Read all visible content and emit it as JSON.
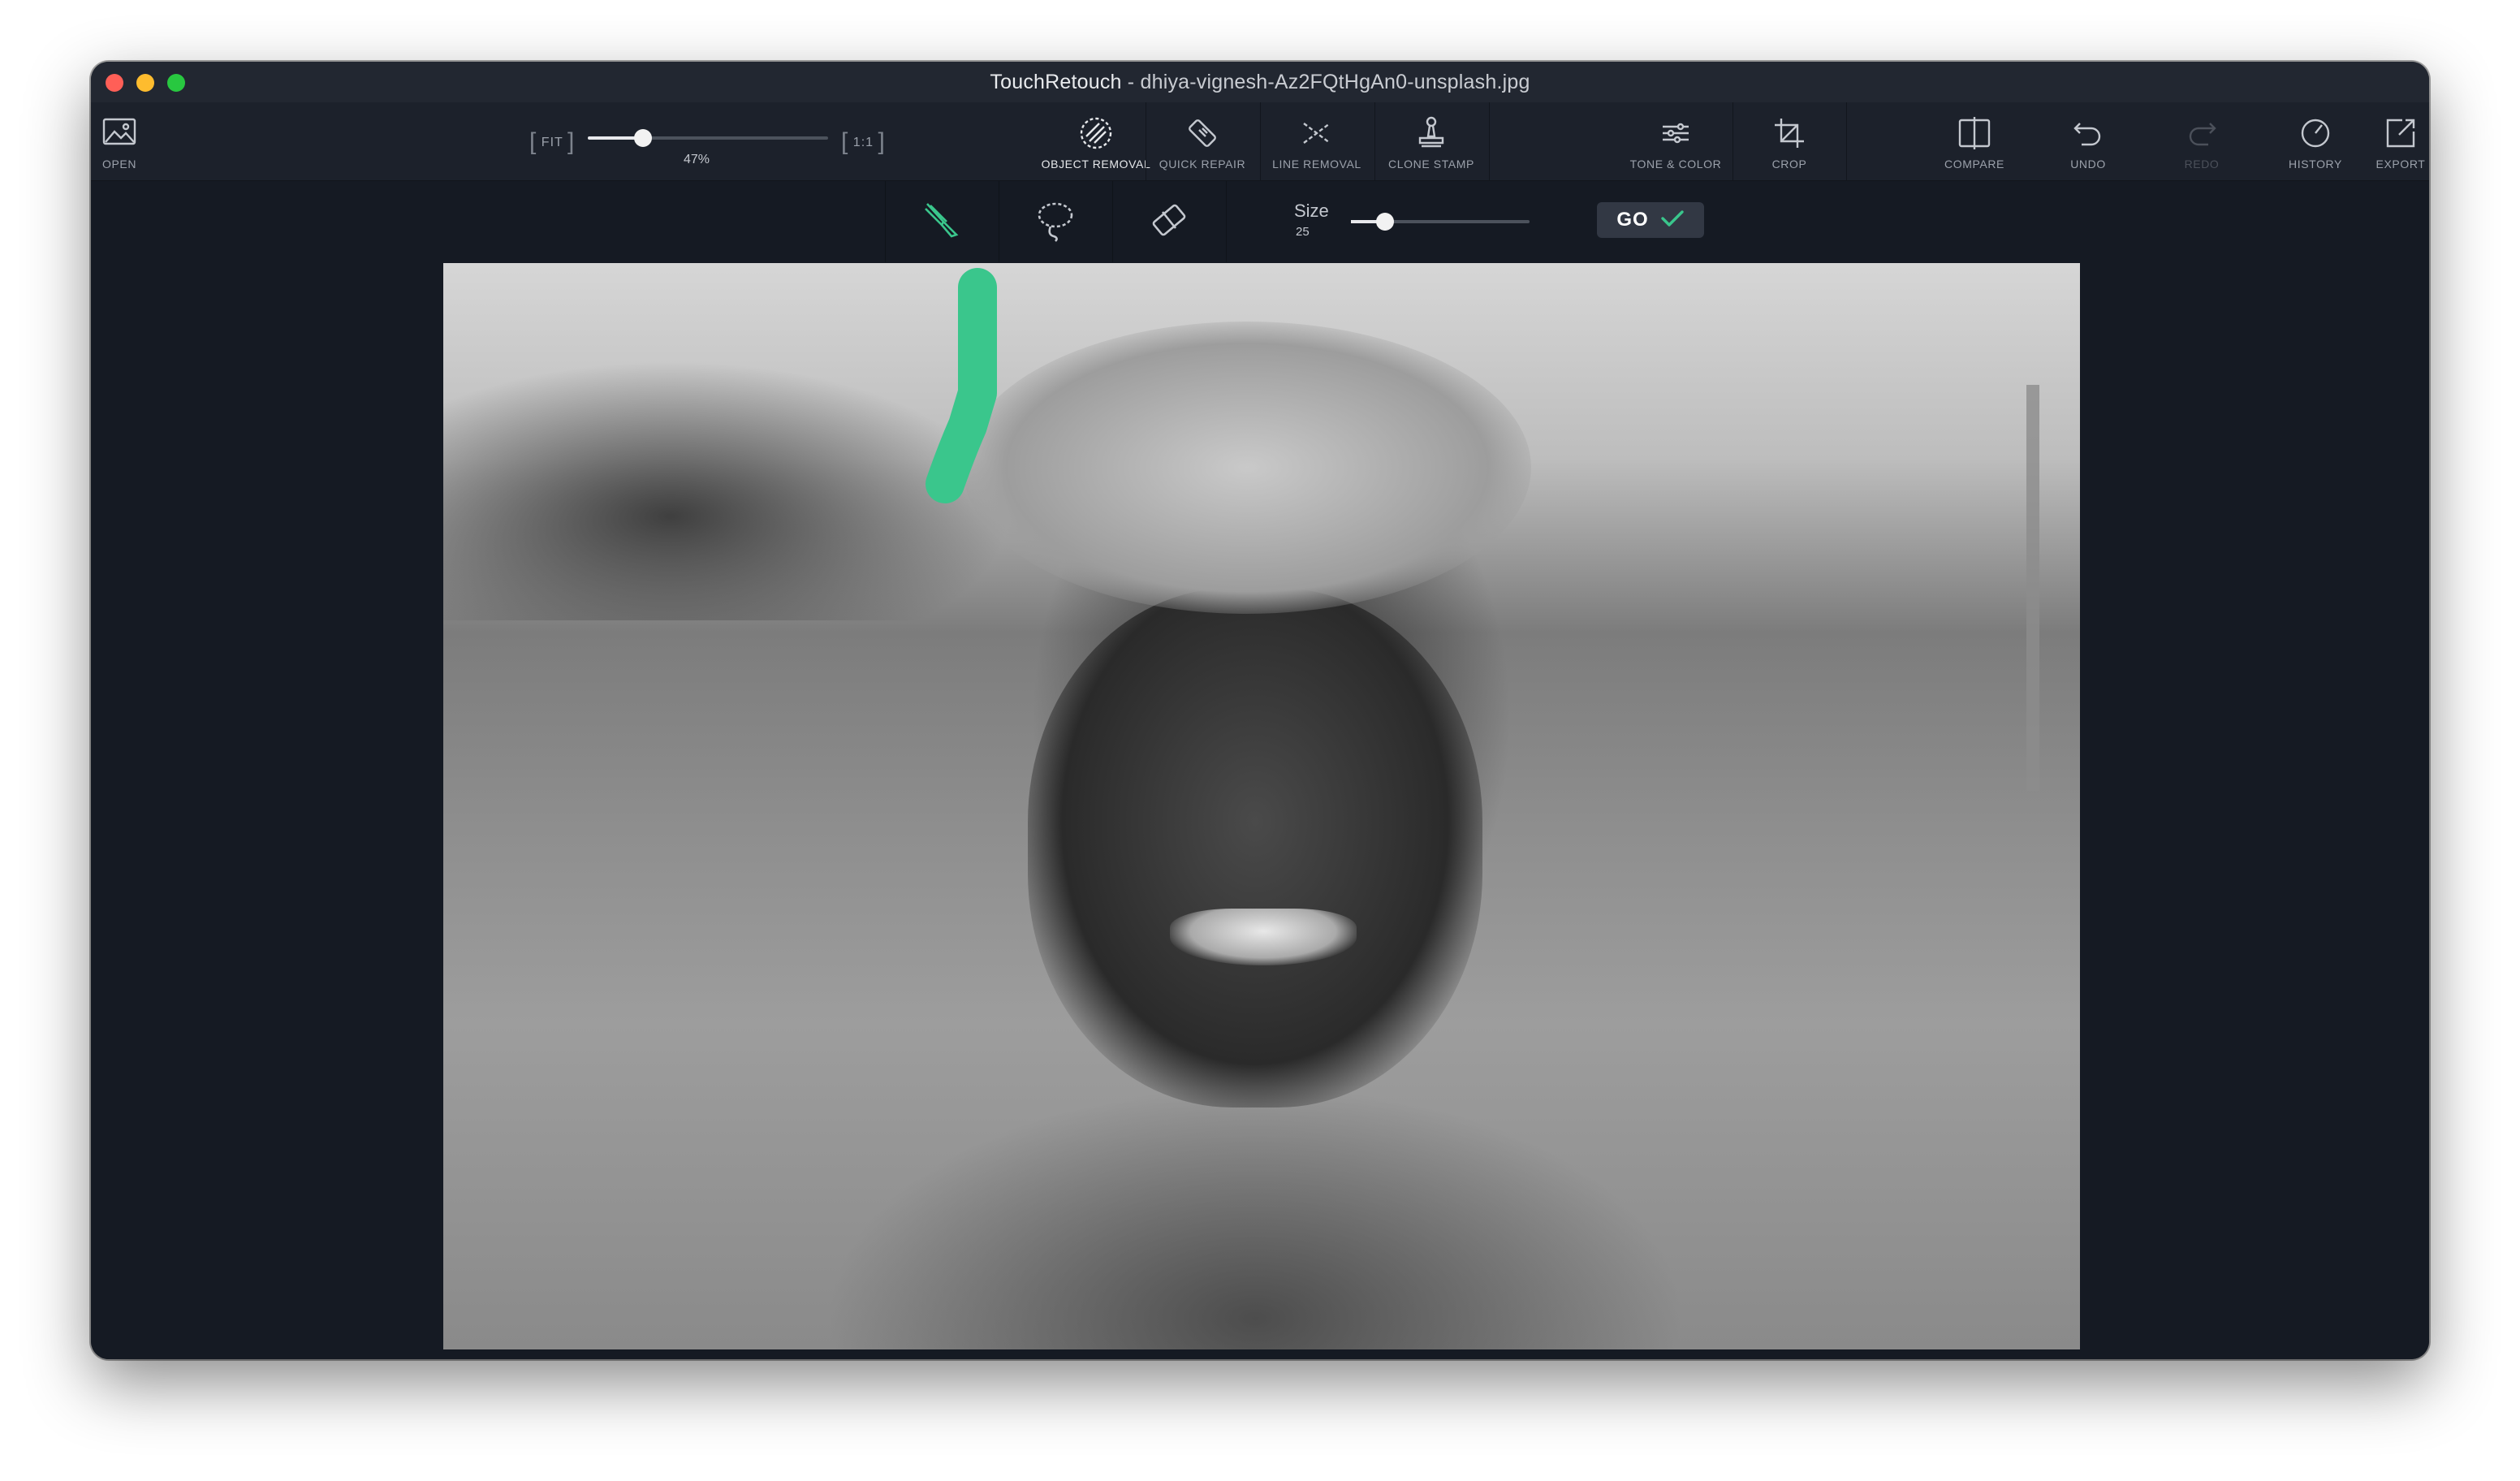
{
  "window": {
    "app_name": "TouchRetouch",
    "separator": " - ",
    "file_name": "dhiya-vignesh-Az2FQtHgAn0-unsplash.jpg"
  },
  "toolbar": {
    "open_label": "OPEN",
    "zoom": {
      "fit_label": "FIT",
      "one_to_one_label": "1:1",
      "percent_label": "47%",
      "value_fraction": 0.23
    },
    "tools": [
      {
        "label": "OBJECT REMOVAL",
        "icon": "object-removal-icon",
        "active": true
      },
      {
        "label": "QUICK REPAIR",
        "icon": "quick-repair-icon",
        "active": false
      },
      {
        "label": "LINE REMOVAL",
        "icon": "line-removal-icon",
        "active": false
      },
      {
        "label": "CLONE STAMP",
        "icon": "clone-stamp-icon",
        "active": false
      },
      {
        "label": "TONE & COLOR",
        "icon": "tone-color-icon",
        "active": false
      },
      {
        "label": "CROP",
        "icon": "crop-icon",
        "active": false
      }
    ],
    "compare_label": "COMPARE",
    "undo_label": "UNDO",
    "redo_label": "REDO",
    "redo_enabled": false,
    "history_label": "HISTORY",
    "export_label": "EXPORT"
  },
  "subtoolbar": {
    "tools": [
      {
        "icon": "brush-icon",
        "active": true
      },
      {
        "icon": "lasso-icon",
        "active": false
      },
      {
        "icon": "eraser-icon",
        "active": false
      }
    ],
    "size_label": "Size",
    "size_value": "25",
    "size_fraction": 0.19,
    "go_label": "GO"
  },
  "colors": {
    "accent": "#3ac68c",
    "background": "#151a23",
    "toolbar": "#1c212b"
  }
}
